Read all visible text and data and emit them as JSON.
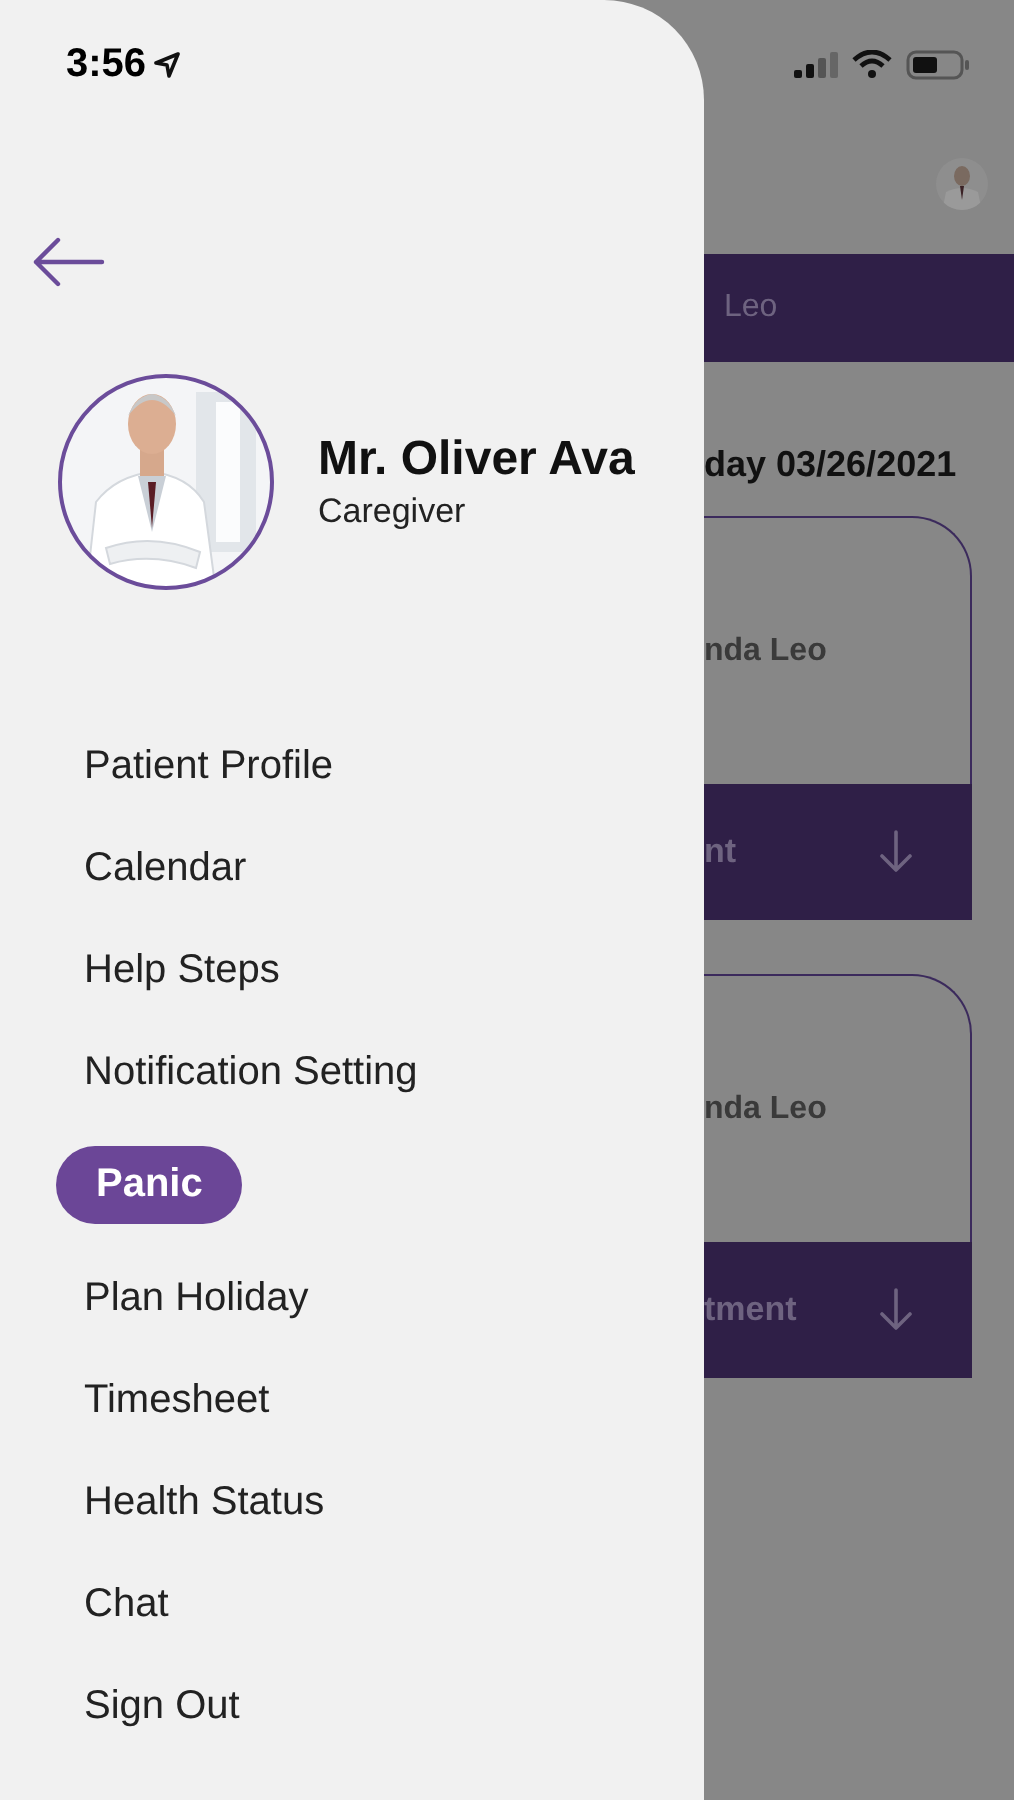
{
  "status_bar": {
    "time": "3:56"
  },
  "drawer": {
    "profile": {
      "name": "Mr. Oliver Ava",
      "role": "Caregiver"
    },
    "menu": [
      {
        "label": "Patient Profile",
        "selected": false
      },
      {
        "label": "Calendar",
        "selected": false
      },
      {
        "label": "Help Steps",
        "selected": false
      },
      {
        "label": "Notification Setting",
        "selected": false
      },
      {
        "label": "Panic",
        "selected": true
      },
      {
        "label": "Plan Holiday",
        "selected": false
      },
      {
        "label": "Timesheet",
        "selected": false
      },
      {
        "label": "Health Status",
        "selected": false
      },
      {
        "label": "Chat",
        "selected": false
      },
      {
        "label": "Sign Out",
        "selected": false
      }
    ]
  },
  "background": {
    "banner": "Leo",
    "date": "day 03/26/2021",
    "cards": [
      {
        "name": "nda Leo",
        "action": "nt"
      },
      {
        "name": "nda Leo",
        "action": "tment"
      }
    ]
  }
}
